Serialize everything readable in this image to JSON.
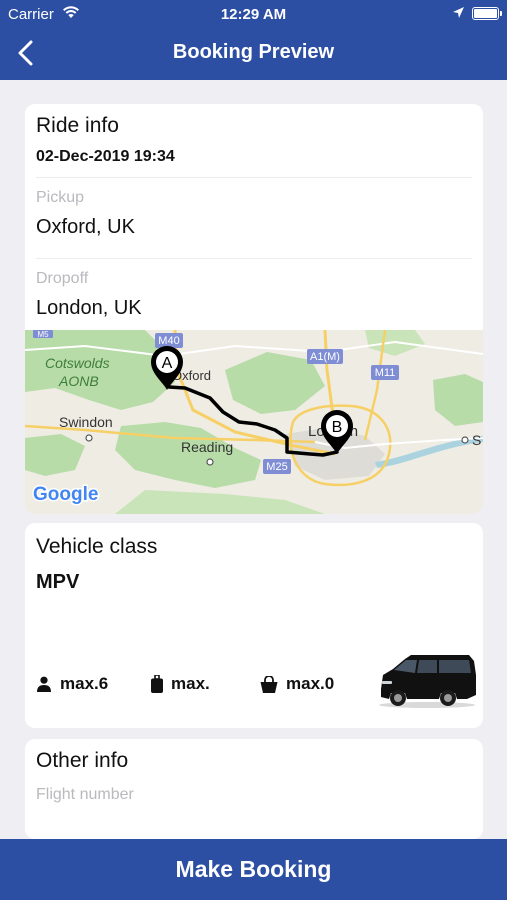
{
  "status_bar": {
    "carrier": "Carrier",
    "time": "12:29 AM"
  },
  "nav": {
    "title": "Booking Preview",
    "back_icon": "chevron-left-icon"
  },
  "ride_info": {
    "heading": "Ride info",
    "datetime": "02-Dec-2019 19:34",
    "pickup_label": "Pickup",
    "pickup_value": "Oxford, UK",
    "dropoff_label": "Dropoff",
    "dropoff_value": "London, UK",
    "map": {
      "places": [
        "Cotswolds",
        "AONB",
        "Swindon",
        "Reading",
        "London",
        "S"
      ],
      "oxford_label": "Oxford",
      "roads": [
        "M5",
        "M40",
        "A1(M)",
        "M11",
        "M25"
      ],
      "marker_a": "A",
      "marker_b": "B",
      "provider": "Google"
    }
  },
  "vehicle": {
    "heading": "Vehicle class",
    "class_name": "MPV",
    "passengers": "max.6",
    "luggage": "max.",
    "bags": "max.0"
  },
  "other_info": {
    "heading": "Other info",
    "flight_label": "Flight number"
  },
  "action": {
    "make_booking": "Make Booking"
  },
  "colors": {
    "brand": "#2c4ea3",
    "background": "#eeeef3",
    "muted_text": "#b9b9be"
  }
}
